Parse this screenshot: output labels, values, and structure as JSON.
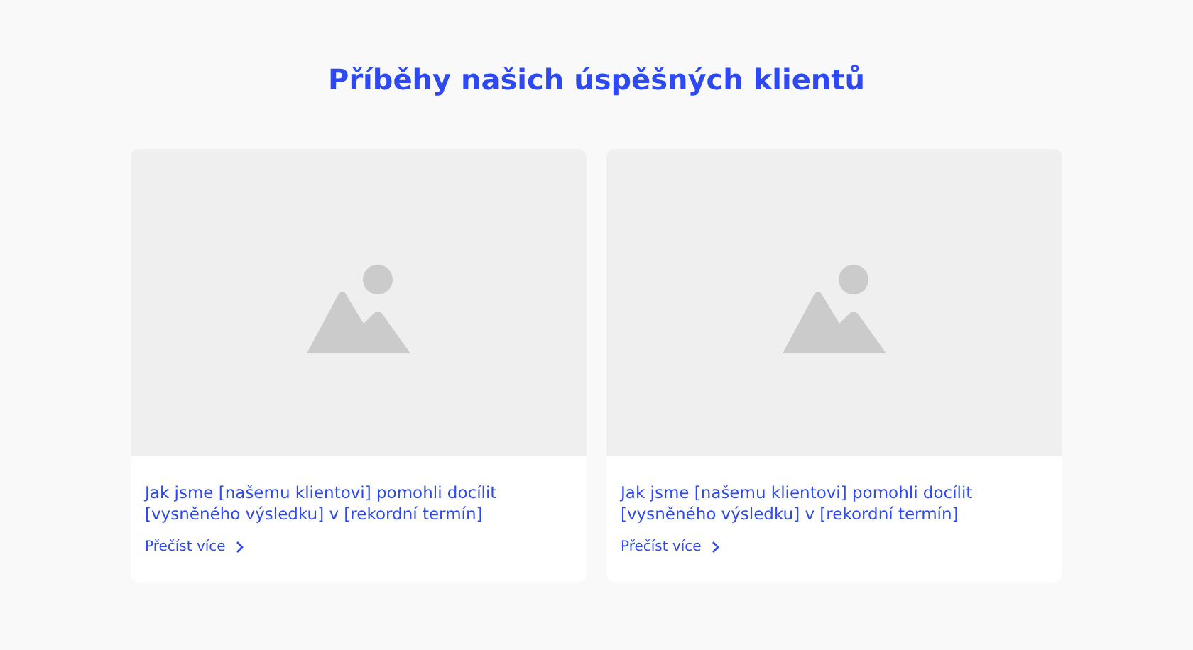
{
  "heading": "Příběhy našich úspěšných klientů",
  "cards": [
    {
      "title": "Jak jsme [našemu klientovi] pomohli docílit [vysněného výsledku] v [rekordní termín]",
      "link": "Přečíst více"
    },
    {
      "title": "Jak jsme [našemu klientovi] pomohli docílit [vysněného výsledku] v [rekordní termín]",
      "link": "Přečíst více"
    }
  ]
}
